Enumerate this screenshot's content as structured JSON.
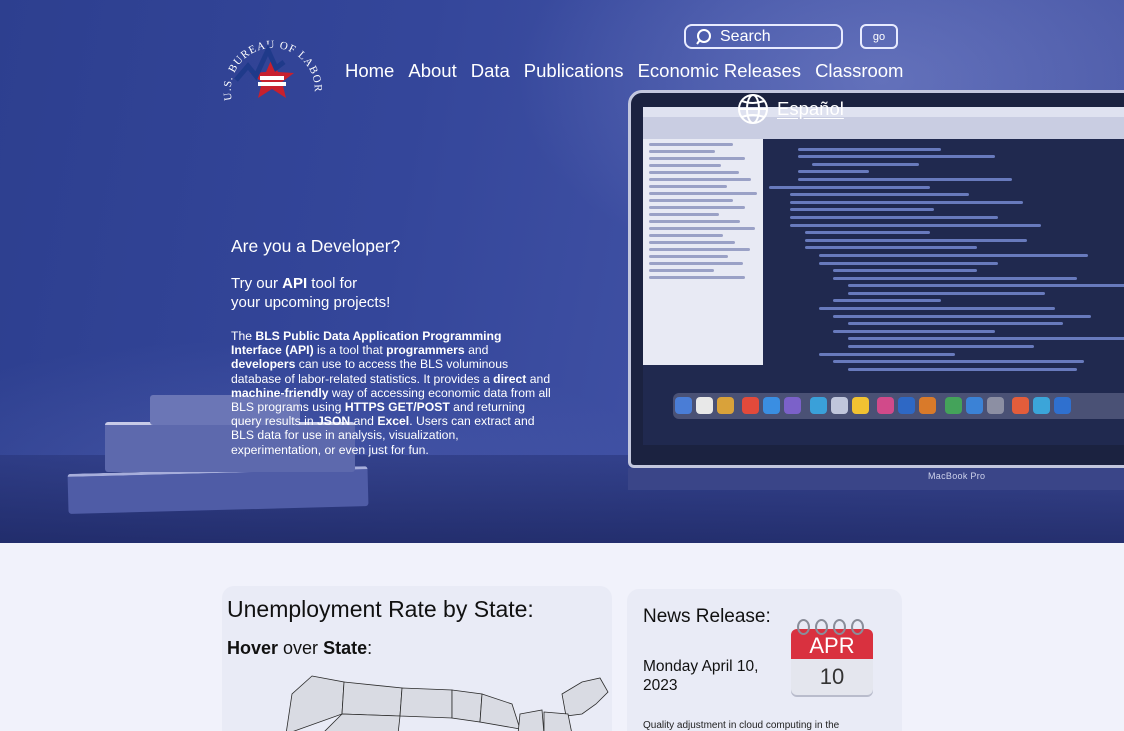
{
  "header": {
    "logo_text": "U.S. BUREAU OF LABOR STATISTICS",
    "search": {
      "placeholder": "Search",
      "go_label": "go"
    },
    "nav": [
      "Home",
      "About",
      "Data",
      "Publications",
      "Economic Releases",
      "Classroom"
    ],
    "language_link": "Español",
    "laptop_brand": "MacBook Pro"
  },
  "developer": {
    "heading": "Are you a Developer?",
    "try_prefix": "Try our ",
    "try_strong": "API",
    "try_suffix": " tool for",
    "try_line2": "your upcoming projects!",
    "body": [
      {
        "t": "The ",
        "b": false
      },
      {
        "t": "BLS Public Data Application Programming Interface (API)",
        "b": true
      },
      {
        "t": " is a tool that ",
        "b": false
      },
      {
        "t": "programmers",
        "b": true
      },
      {
        "t": " and ",
        "b": false
      },
      {
        "t": "developers",
        "b": true
      },
      {
        "t": " can use to access the BLS voluminous database of labor-related statistics. It provides a ",
        "b": false
      },
      {
        "t": "direct",
        "b": true
      },
      {
        "t": " and ",
        "b": false
      },
      {
        "t": "machine-friendly",
        "b": true
      },
      {
        "t": " way of accessing economic data from all BLS programs using ",
        "b": false
      },
      {
        "t": "HTTPS GET/POST",
        "b": true
      },
      {
        "t": " and returning query results in ",
        "b": false
      },
      {
        "t": "JSON",
        "b": true
      },
      {
        "t": " and ",
        "b": false
      },
      {
        "t": "Excel",
        "b": true
      },
      {
        "t": ". Users can extract and BLS data for use in analysis, visualization, experimentation, or even just for fun.",
        "b": false
      }
    ]
  },
  "unemployment": {
    "title": "Unemployment Rate by State:",
    "hover_strong1": "Hover",
    "hover_mid": " over ",
    "hover_strong2": "State",
    "hover_end": ":"
  },
  "news": {
    "title": "News Release:",
    "date": "Monday April 10, 2023",
    "calendar_month": "APR",
    "calendar_day": "10",
    "snippet": "Quality adjustment in cloud computing in the"
  },
  "colors": {
    "hero": "#34469a",
    "calendar_red": "#d9313f",
    "logo_red": "#c8202e",
    "logo_blue": "#1f3a8a"
  }
}
